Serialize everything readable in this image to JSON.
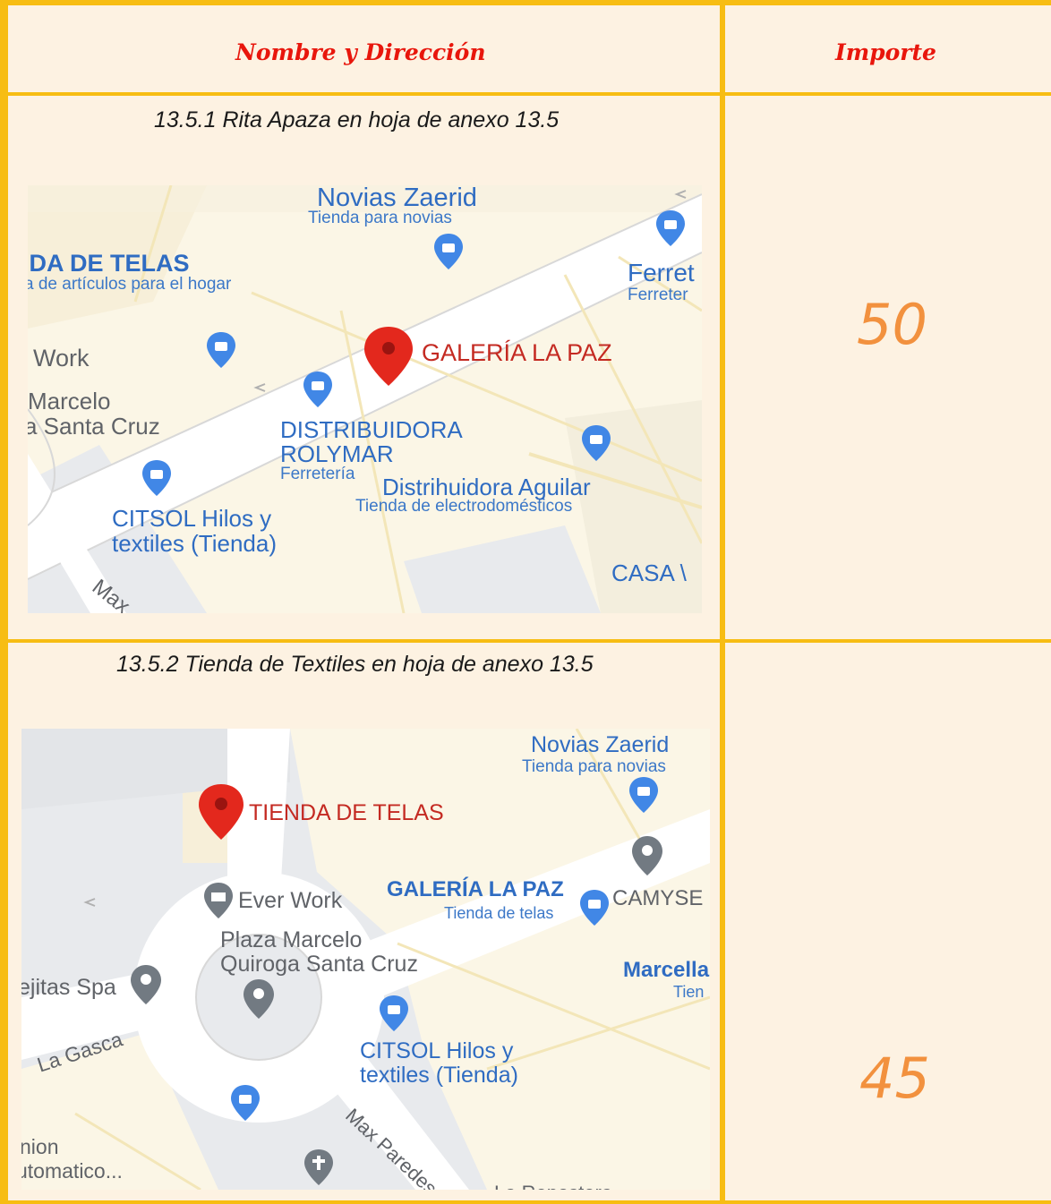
{
  "header": {
    "name_address": "Nombre y Dirección",
    "amount": "Importe"
  },
  "rows": [
    {
      "caption": "13.5.1 Rita Apaza en hoja de anexo 13.5",
      "amount": "50",
      "map": {
        "labels": {
          "novias_title": "Novias Zaerid",
          "novias_sub": "Tienda para novias",
          "telas_title": "IDA DE TELAS",
          "telas_sub": "a de artículos para el hogar",
          "ferret_title": "Ferret",
          "ferret_sub": "Ferreter",
          "work": "Work",
          "marcelo": "Marcelo",
          "santa_cruz": "a Santa Cruz",
          "galeria": "GALERÍA LA PAZ",
          "distribuidora1": "DISTRIBUIDORA",
          "distribuidora2": "ROLYMAR",
          "ferreteria": "Ferretería",
          "aguilar": "Distrihuidora Aguilar",
          "aguilar_sub": "Tienda de electrodomésticos",
          "citsol1": "CITSOL Hilos y",
          "citsol2": "textiles (Tienda)",
          "casa": "CASA \\",
          "max": "Max"
        }
      }
    },
    {
      "caption": "13.5.2 Tienda de Textiles en hoja de anexo 13.5",
      "amount": "45",
      "map": {
        "labels": {
          "novias_title": "Novias Zaerid",
          "novias_sub": "Tienda para novias",
          "tienda_telas": "TIENDA DE TELAS",
          "ever_work": "Ever Work",
          "galeria": "GALERÍA LA PAZ",
          "galeria_sub": "Tienda de telas",
          "camyse": "CAMYSE",
          "plaza1": "Plaza Marcelo",
          "plaza2": "Quiroga Santa Cruz",
          "ejitas": "ejitas Spa",
          "marcella": "Marcella",
          "marcella_sub": "Tien",
          "la_gasca": "La Gasca",
          "citsol1": "CITSOL Hilos y",
          "citsol2": "textiles (Tienda)",
          "union": "nion",
          "automatico": "utomatico...",
          "max_paredes": "Max Paredes",
          "la_repostera": "La Repostera"
        }
      }
    }
  ]
}
